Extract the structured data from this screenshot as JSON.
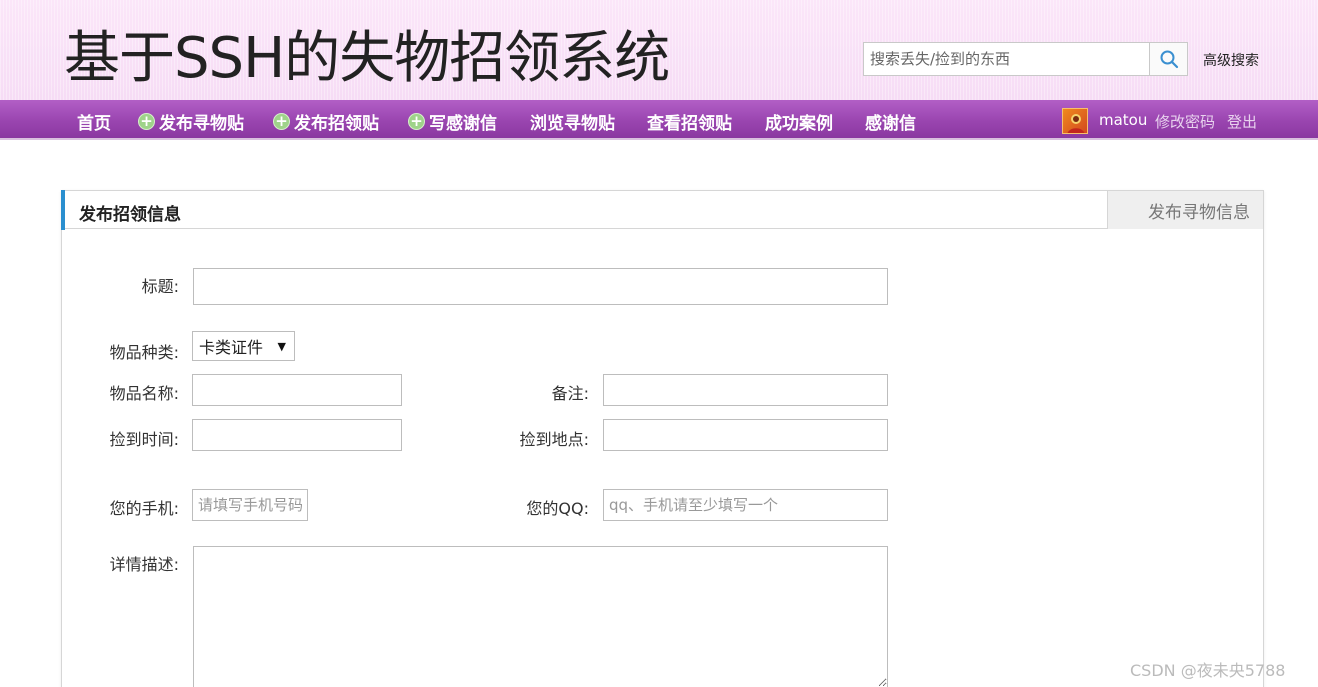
{
  "header": {
    "site_title": "基于SSH的失物招领系统",
    "search_placeholder": "搜索丢失/捡到的东西",
    "advanced_search": "高级搜索"
  },
  "nav": {
    "items": [
      {
        "label": "首页",
        "icon": null
      },
      {
        "label": "发布寻物贴",
        "icon": "plus-circle-icon"
      },
      {
        "label": "发布招领贴",
        "icon": "plus-circle-icon"
      },
      {
        "label": "写感谢信",
        "icon": "plus-circle-icon"
      },
      {
        "label": "浏览寻物贴",
        "icon": null
      },
      {
        "label": "查看招领贴",
        "icon": null
      },
      {
        "label": "成功案例",
        "icon": null
      },
      {
        "label": "感谢信",
        "icon": null
      }
    ],
    "user": {
      "name": "matou",
      "change_password": "修改密码",
      "logout": "登出"
    }
  },
  "panel": {
    "title": "发布招领信息",
    "tab_other": "发布寻物信息",
    "accent_color": "#2a8fcf"
  },
  "form": {
    "title_label": "标题:",
    "title_value": "",
    "category_label": "物品种类:",
    "category_value": "卡类证件",
    "item_name_label": "物品名称:",
    "item_name_value": "",
    "remark_label": "备注:",
    "remark_value": "",
    "found_time_label": "捡到时间:",
    "found_time_value": "",
    "found_place_label": "捡到地点:",
    "found_place_value": "",
    "phone_label": "您的手机:",
    "phone_placeholder": "请填写手机号码",
    "qq_label": "您的QQ:",
    "qq_placeholder": "qq、手机请至少填写一个",
    "detail_label": "详情描述:",
    "detail_value": ""
  },
  "watermark": "CSDN @夜未央5788",
  "colors": {
    "nav_purple": "#9a45b0",
    "header_pink": "#f6dcf5"
  }
}
